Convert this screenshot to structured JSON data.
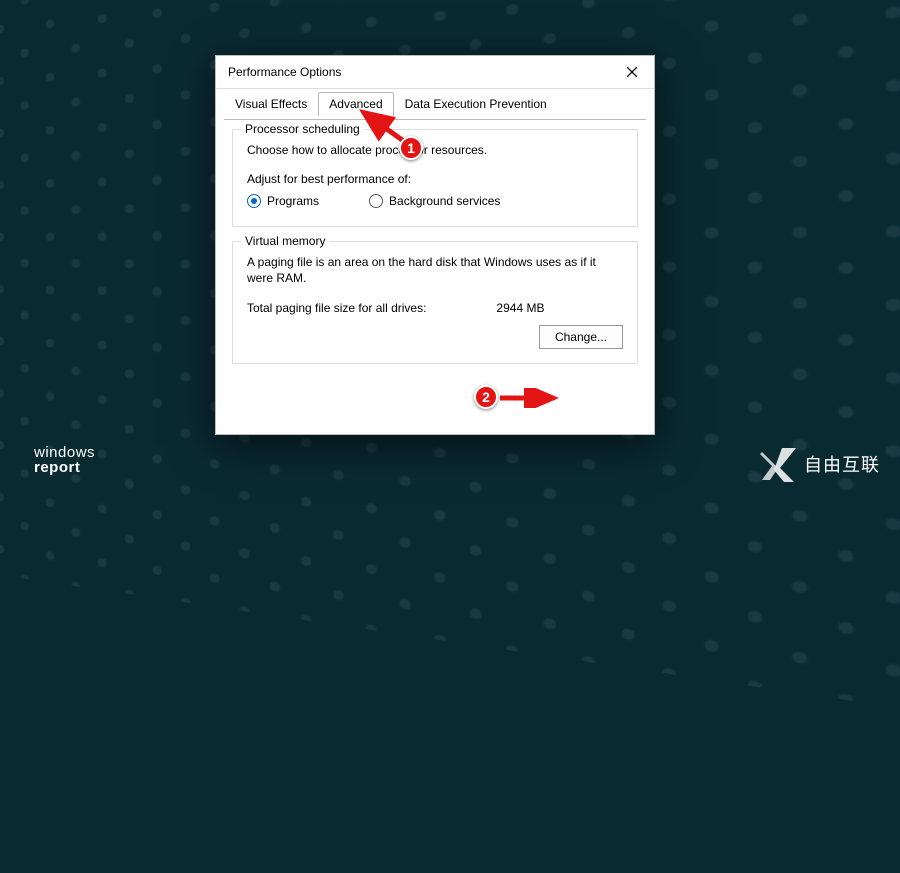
{
  "window": {
    "title": "Performance Options"
  },
  "tabs": [
    {
      "label": "Visual Effects",
      "active": false
    },
    {
      "label": "Advanced",
      "active": true
    },
    {
      "label": "Data Execution Prevention",
      "active": false
    }
  ],
  "processor_scheduling": {
    "legend": "Processor scheduling",
    "description": "Choose how to allocate processor resources.",
    "sublabel": "Adjust for best performance of:",
    "options": {
      "programs": "Programs",
      "background": "Background services"
    },
    "selected": "programs"
  },
  "virtual_memory": {
    "legend": "Virtual memory",
    "description": "A paging file is an area on the hard disk that Windows uses as if it were RAM.",
    "total_label": "Total paging file size for all drives:",
    "total_value": "2944 MB",
    "change_button": "Change..."
  },
  "annotations": {
    "1": "1",
    "2": "2"
  },
  "watermarks": {
    "left_line1": "windows",
    "left_line2": "report",
    "right": "自由互联"
  }
}
